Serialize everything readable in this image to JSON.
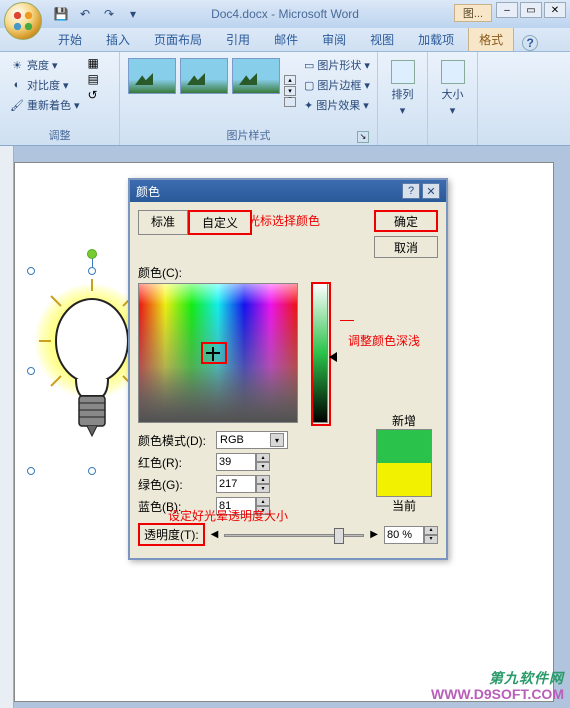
{
  "titlebar": {
    "doc_title": "Doc4.docx - Microsoft Word",
    "context_label": "图..."
  },
  "tabs": {
    "t0": "开始",
    "t1": "插入",
    "t2": "页面布局",
    "t3": "引用",
    "t4": "邮件",
    "t5": "审阅",
    "t6": "视图",
    "t7": "加载项",
    "t8": "格式"
  },
  "ribbon": {
    "adjust": {
      "brightness": "亮度",
      "contrast": "对比度",
      "recolor": "重新着色",
      "label": "调整"
    },
    "styles": {
      "shape": "图片形状",
      "border": "图片边框",
      "effects": "图片效果",
      "label": "图片样式"
    },
    "arrange": {
      "label_btn": "排列"
    },
    "size": {
      "label_btn": "大小"
    }
  },
  "dialog": {
    "title": "颜色",
    "tab_standard": "标准",
    "tab_custom": "自定义",
    "annot_cursor": "光标选择颜色",
    "annot_lum": "调整颜色深浅",
    "annot_trans": "设定好光晕透明度大小",
    "btn_ok": "确定",
    "btn_cancel": "取消",
    "lbl_color": "颜色(C):",
    "lbl_mode": "颜色模式(D):",
    "mode_value": "RGB",
    "lbl_red": "红色(R):",
    "lbl_green": "绿色(G):",
    "lbl_blue": "蓝色(B):",
    "val_red": "39",
    "val_green": "217",
    "val_blue": "81",
    "lbl_new": "新增",
    "lbl_current": "当前",
    "lbl_trans": "透明度(T):",
    "val_trans": "80 %"
  },
  "watermark": {
    "line1": "第九软件网",
    "line2": "WWW.D9SOFT.COM"
  }
}
